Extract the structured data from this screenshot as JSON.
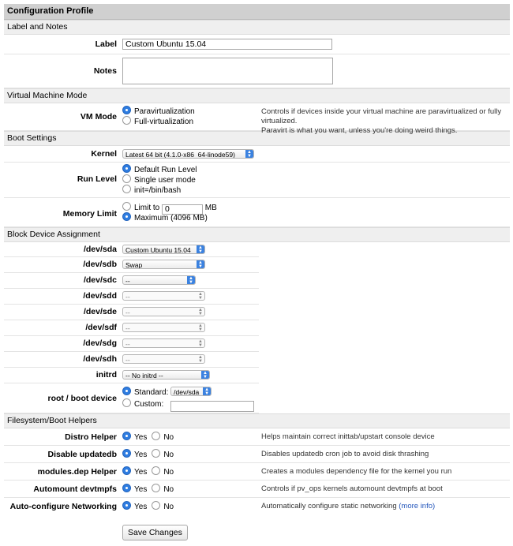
{
  "title": "Configuration Profile",
  "sections": {
    "label_notes": "Label and Notes",
    "vm_mode": "Virtual Machine Mode",
    "boot": "Boot Settings",
    "block": "Block Device Assignment",
    "helpers": "Filesystem/Boot Helpers"
  },
  "label_field": {
    "label": "Label",
    "value": "Custom Ubuntu 15.04"
  },
  "notes_field": {
    "label": "Notes",
    "value": ""
  },
  "vm_mode": {
    "label": "VM Mode",
    "options": [
      "Paravirtualization",
      "Full-virtualization"
    ],
    "selected": 0,
    "help_line1": "Controls if devices inside your virtual machine are paravirtualized or fully virtualized.",
    "help_line2": "Paravirt is what you want, unless you're doing weird things."
  },
  "kernel": {
    "label": "Kernel",
    "value": "Latest 64 bit (4.1.0-x86_64-linode59)"
  },
  "run_level": {
    "label": "Run Level",
    "options": [
      "Default Run Level",
      "Single user mode",
      "init=/bin/bash"
    ],
    "selected": 0
  },
  "memory_limit": {
    "label": "Memory Limit",
    "limit_label": "Limit to",
    "limit_value": "0",
    "unit": "MB",
    "maximum_label": "Maximum (4096 MB)",
    "selected": "maximum"
  },
  "devices": [
    {
      "label": "/dev/sda",
      "value": "Custom Ubuntu 15.04",
      "active": true
    },
    {
      "label": "/dev/sdb",
      "value": "Swap",
      "active": true
    },
    {
      "label": "/dev/sdc",
      "value": "--",
      "active": true
    },
    {
      "label": "/dev/sdd",
      "value": "--",
      "active": false
    },
    {
      "label": "/dev/sde",
      "value": "--",
      "active": false
    },
    {
      "label": "/dev/sdf",
      "value": "--",
      "active": false
    },
    {
      "label": "/dev/sdg",
      "value": "--",
      "active": false
    },
    {
      "label": "/dev/sdh",
      "value": "--",
      "active": false
    }
  ],
  "initrd": {
    "label": "initrd",
    "value": "-- No initrd --"
  },
  "root_device": {
    "label": "root / boot device",
    "standard_label": "Standard:",
    "standard_value": "/dev/sda",
    "custom_label": "Custom:",
    "custom_value": "",
    "selected": "standard"
  },
  "yes_label": "Yes",
  "no_label": "No",
  "helpers": [
    {
      "label": "Distro Helper",
      "help": "Helps maintain correct inittab/upstart console device",
      "value": "yes"
    },
    {
      "label": "Disable updatedb",
      "help": "Disables updatedb cron job to avoid disk thrashing",
      "value": "yes"
    },
    {
      "label": "modules.dep Helper",
      "help": "Creates a modules dependency file for the kernel you run",
      "value": "yes"
    },
    {
      "label": "Automount devtmpfs",
      "help": "Controls if pv_ops kernels automount devtmpfs at boot",
      "value": "yes"
    },
    {
      "label": "Auto-configure Networking",
      "help": "Automatically configure static networking",
      "link": "(more info)",
      "value": "yes"
    }
  ],
  "save_button": "Save Changes",
  "colors": {
    "radio_selected": "#2f7de1",
    "select_arrow": "#3b82e0",
    "link": "#2255bb",
    "title_bg": "#d0d0d0",
    "section_bg": "#efefef"
  }
}
